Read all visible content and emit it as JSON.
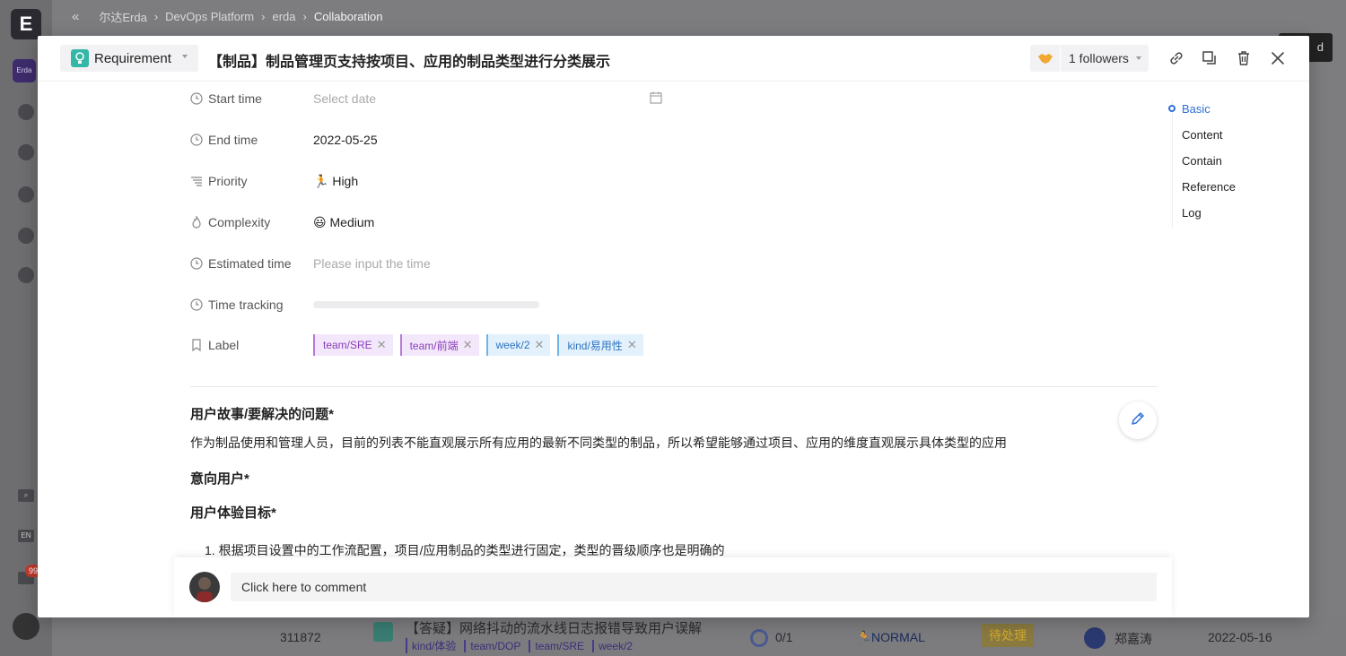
{
  "background": {
    "breadcrumb": [
      "尔达Erda",
      "DevOps Platform",
      "erda",
      "Collaboration"
    ],
    "logo_letter": "E",
    "app_badge": "Erda",
    "lang_badge": "EN",
    "notify_count": "99",
    "right_button": "d",
    "row": {
      "id": "311872",
      "title": "【答疑】网络抖动的流水线日志报错导致用户误解",
      "tags": [
        "kind/体验",
        "team/DOP",
        "team/SRE",
        "week/2"
      ],
      "progress": "0/1",
      "priority": "NORMAL",
      "state": "待处理",
      "assignee": "郑嘉涛",
      "date": "2022-05-16"
    }
  },
  "modal": {
    "type_label": "Requirement",
    "title": "【制品】制品管理页支持按项目、应用的制品类型进行分类展示",
    "followers": "1 followers",
    "fields": {
      "start_time": {
        "label": "Start time",
        "value": "Select date"
      },
      "end_time": {
        "label": "End time",
        "value": "2022-05-25"
      },
      "priority": {
        "label": "Priority",
        "value": "High"
      },
      "complexity": {
        "label": "Complexity",
        "value": "Medium"
      },
      "estimated_time": {
        "label": "Estimated time",
        "value": "Please input the time"
      },
      "time_tracking": {
        "label": "Time tracking"
      },
      "label": {
        "label": "Label",
        "tags": [
          "team/SRE",
          "team/前端",
          "week/2",
          "kind/易用性"
        ]
      }
    },
    "content": {
      "h1": "用户故事/要解决的问题*",
      "p1": "作为制品使用和管理人员，目前的列表不能直观展示所有应用的最新不同类型的制品，所以希望能够通过项目、应用的维度直观展示具体类型的应用",
      "h2": "意向用户*",
      "h3": "用户体验目标*",
      "list_item_1": "1. 根据项目设置中的工作流配置，项目/应用制品的类型进行固定，类型的晋级顺序也是明确的"
    },
    "anchors": [
      "Basic",
      "Content",
      "Contain",
      "Reference",
      "Log"
    ],
    "comment_placeholder": "Click here to comment",
    "colors": {
      "accent": "#2e6fd9",
      "type_icon": "#34b7a7"
    }
  }
}
